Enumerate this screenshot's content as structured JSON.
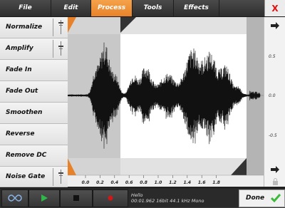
{
  "menu": {
    "items": [
      {
        "label": "File"
      },
      {
        "label": "Edit"
      },
      {
        "label": "Process"
      },
      {
        "label": "Tools"
      },
      {
        "label": "Effects"
      }
    ],
    "active": "Process",
    "close_label": "X"
  },
  "sidebar": {
    "items": [
      {
        "label": "Normalize"
      },
      {
        "label": "Amplify"
      },
      {
        "label": "Fade In"
      },
      {
        "label": "Fade Out"
      },
      {
        "label": "Smoothen"
      },
      {
        "label": "Reverse"
      },
      {
        "label": "Remove DC"
      },
      {
        "label": "Noise Gate"
      }
    ]
  },
  "waveform": {
    "x_ticks": [
      "0.0",
      "0.2",
      "0.4",
      "0.6",
      "0.8",
      "1.0",
      "1.2",
      "1.4",
      "1.6",
      "1.8"
    ],
    "y_ticks": [
      "0.5",
      "0.0",
      "-0.5"
    ]
  },
  "status": {
    "line1": "Hello",
    "line2": "00:01.962 16bit 44.1 kHz Mono"
  },
  "done_label": "Done",
  "colors": {
    "accent": "#e8822a",
    "done_check": "#3cb83c",
    "play": "#2fb84a",
    "record": "#d01818",
    "close": "#e01010"
  }
}
